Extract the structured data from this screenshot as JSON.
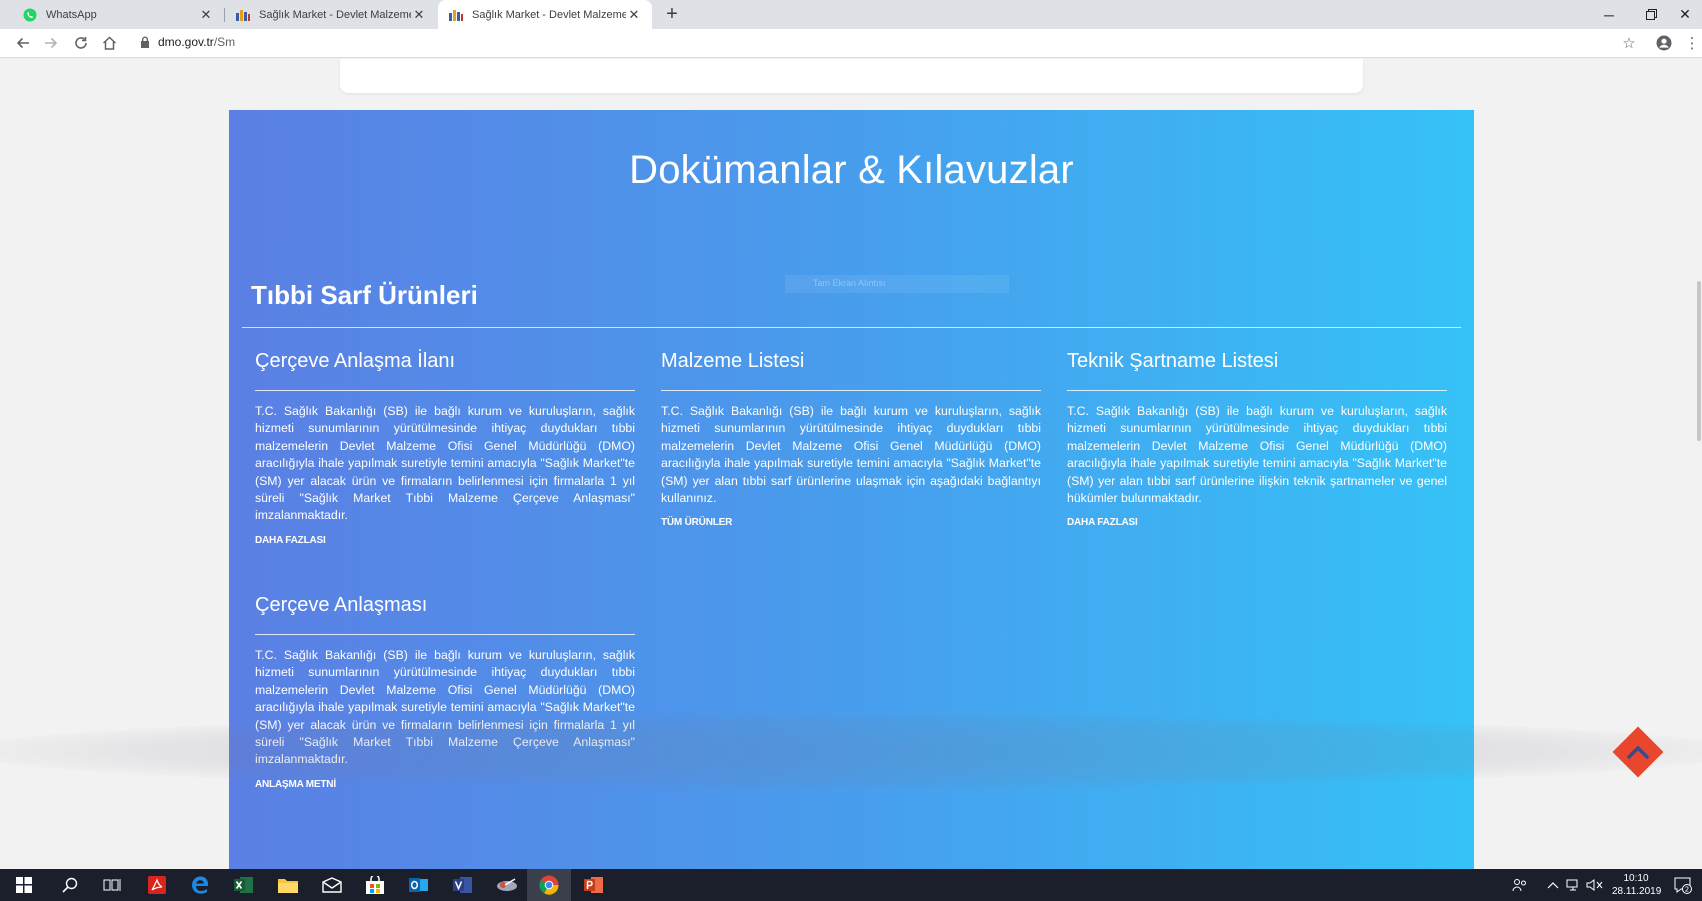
{
  "browser": {
    "tabs": [
      {
        "title": "WhatsApp",
        "favicon": "whatsapp-icon",
        "active": false
      },
      {
        "title": "Sağlık Market - Devlet Malzeme Ofisi",
        "favicon": "dmo-logo-icon",
        "active": false
      },
      {
        "title": "Sağlık Market - Devlet Malzeme Ofisi",
        "favicon": "dmo-logo-icon",
        "active": true
      }
    ],
    "new_tab_label": "+",
    "address": {
      "host": "dmo.gov.tr",
      "path": "/Sm"
    }
  },
  "page": {
    "section_title": "Dokümanlar & Kılavuzlar",
    "category_title": "Tıbbi Sarf Ürünleri",
    "faint_overlay_text": "Tam Ekran Alıntısı",
    "columns": [
      {
        "heading": "Çerçeve Anlaşma İlanı",
        "body": "T.C. Sağlık Bakanlığı (SB) ile bağlı kurum ve kuruluşların, sağlık hizmeti sunumlarının yürütülmesinde ihtiyaç duydukları tıbbi malzemelerin Devlet Malzeme Ofisi Genel Müdürlüğü (DMO) aracılığıyla ihale yapılmak suretiyle temini amacıyla \"Sağlık Market\"te (SM) yer alacak ürün ve firmaların belirlenmesi için firmalarla 1 yıl süreli \"Sağlık Market Tıbbi Malzeme Çerçeve Anlaşması\" imzalanmaktadır.",
        "link": "DAHA FAZLASI"
      },
      {
        "heading": "Malzeme Listesi",
        "body": "T.C. Sağlık Bakanlığı (SB) ile bağlı kurum ve kuruluşların, sağlık hizmeti sunumlarının yürütülmesinde ihtiyaç duydukları tıbbi malzemelerin Devlet Malzeme Ofisi Genel Müdürlüğü (DMO) aracılığıyla ihale yapılmak suretiyle temini amacıyla \"Sağlık Market\"te (SM) yer alan tıbbi sarf ürünlerine ulaşmak için aşağıdaki bağlantıyı kullanınız.",
        "link": "TÜM ÜRÜNLER"
      },
      {
        "heading": "Teknik Şartname Listesi",
        "body": "T.C. Sağlık Bakanlığı (SB) ile bağlı kurum ve kuruluşların, sağlık hizmeti sunumlarının yürütülmesinde ihtiyaç duydukları tıbbi malzemelerin Devlet Malzeme Ofisi Genel Müdürlüğü (DMO) aracılığıyla ihale yapılmak suretiyle temini amacıyla \"Sağlık Market\"te (SM) yer alan tıbbi sarf ürünlerine ilişkin teknik şartnameler ve genel hükümler bulunmaktadır.",
        "link": "DAHA FAZLASI"
      },
      {
        "heading": "Çerçeve Anlaşması",
        "body": "T.C. Sağlık Bakanlığı (SB) ile bağlı kurum ve kuruluşların, sağlık hizmeti sunumlarının yürütülmesinde ihtiyaç duydukları tıbbi malzemelerin Devlet Malzeme Ofisi Genel Müdürlüğü (DMO) aracılığıyla ihale yapılmak suretiyle temini amacıyla \"Sağlık Market\"te (SM) yer alacak ürün ve firmaların belirlenmesi için firmalarla 1 yıl süreli \"Sağlık Market Tıbbi Malzeme Çerçeve Anlaşması\" imzalanmaktadır.",
        "link": "ANLAŞMA METNİ"
      }
    ]
  },
  "taskbar": {
    "clock_time": "10:10",
    "clock_date": "28.11.2019",
    "notification_count": "2"
  },
  "colors": {
    "gradient_start": "#5b7fe4",
    "gradient_end": "#35c2f7",
    "scroll_top_button": "#e8472e"
  }
}
